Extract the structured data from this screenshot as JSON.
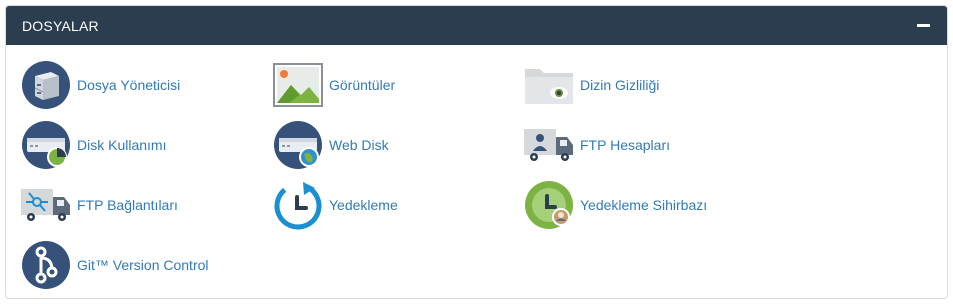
{
  "section": {
    "title": "DOSYALAR",
    "collapse_icon": "minus-icon"
  },
  "items": [
    {
      "label": "Dosya Yöneticisi",
      "icon": "file-cabinet-icon"
    },
    {
      "label": "Görüntüler",
      "icon": "image-icon"
    },
    {
      "label": "Dizin Gizliliği",
      "icon": "folder-eye-icon"
    },
    {
      "label": "Disk Kullanımı",
      "icon": "disk-usage-icon"
    },
    {
      "label": "Web Disk",
      "icon": "web-disk-icon"
    },
    {
      "label": "FTP Hesapları",
      "icon": "ftp-truck-user-icon"
    },
    {
      "label": "FTP Bağlantıları",
      "icon": "ftp-truck-network-icon"
    },
    {
      "label": "Yedekleme",
      "icon": "backup-clock-icon"
    },
    {
      "label": "Yedekleme Sihirbazı",
      "icon": "backup-wizard-icon"
    },
    {
      "label": "Git™ Version Control",
      "icon": "git-icon"
    }
  ],
  "colors": {
    "header_bg": "#2b3d4f",
    "link": "#337ab7",
    "icon_navy": "#2f4a6b",
    "icon_blue": "#1b8fd1",
    "icon_green": "#7cb342"
  }
}
